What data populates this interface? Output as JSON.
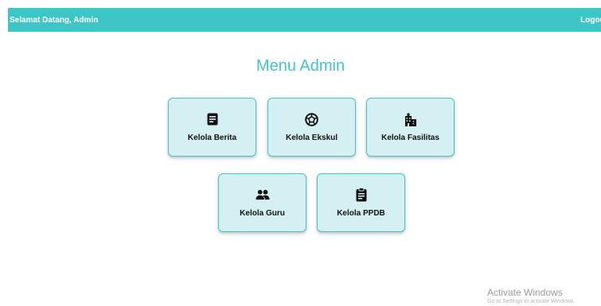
{
  "header": {
    "welcome_text": "Selamat Datang, Admin",
    "logout_label": "Logout",
    "background_color": "#3ec6c6"
  },
  "main": {
    "title": "Menu Admin",
    "menu_items": [
      {
        "label": "Kelola Berita",
        "icon": "news-article-icon"
      },
      {
        "label": "Kelola Ekskul",
        "icon": "soccer-ball-icon"
      },
      {
        "label": "Kelola Fasilitas",
        "icon": "building-icon"
      },
      {
        "label": "Kelola Guru",
        "icon": "people-icon"
      },
      {
        "label": "Kelola PPDB",
        "icon": "clipboard-icon"
      }
    ],
    "card_background": "#d4f0f2",
    "accent_color": "#3ec6c6"
  },
  "os_watermark": {
    "title": "Activate Windows",
    "subtitle": "Go to Settings to activate Windows."
  }
}
